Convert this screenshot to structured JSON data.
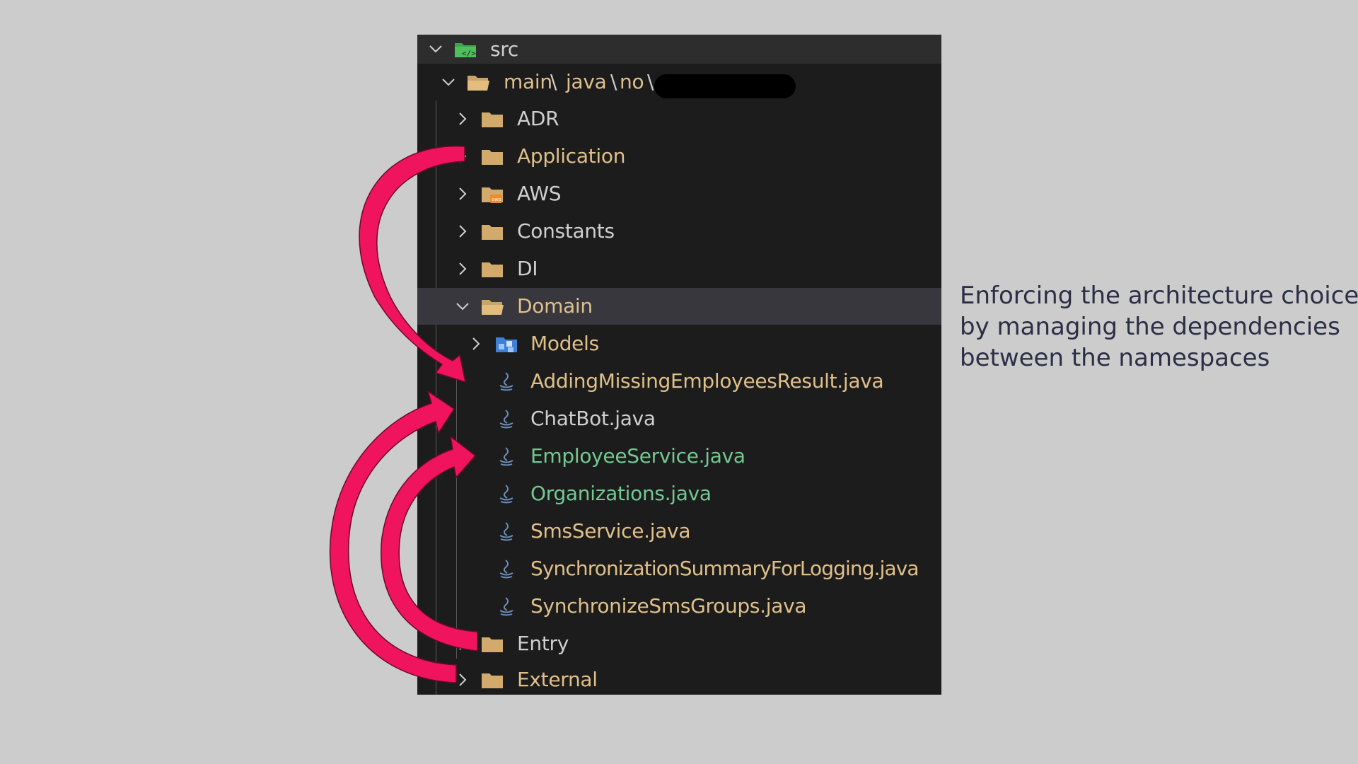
{
  "explorer": {
    "root": {
      "label": "src",
      "icon": "source-folder-icon"
    },
    "package_path": {
      "segments": [
        "main",
        "java",
        "no"
      ],
      "separator": "\\"
    },
    "items": [
      {
        "label": "ADR",
        "icon": "folder-icon",
        "state": "collapsed"
      },
      {
        "label": "Application",
        "icon": "folder-icon",
        "state": "collapsed"
      },
      {
        "label": "AWS",
        "icon": "aws-folder-icon",
        "state": "collapsed"
      },
      {
        "label": "Constants",
        "icon": "folder-icon",
        "state": "collapsed"
      },
      {
        "label": "DI",
        "icon": "folder-icon",
        "state": "collapsed"
      },
      {
        "label": "Domain",
        "icon": "folder-open-icon",
        "state": "expanded",
        "selected": true
      },
      {
        "label": "Models",
        "icon": "models-folder-icon",
        "state": "collapsed"
      },
      {
        "label": "AddingMissingEmployeesResult.java",
        "icon": "java-file-icon",
        "color": "#e0c08a"
      },
      {
        "label": "ChatBot.java",
        "icon": "java-file-icon",
        "color": "#cfcfcf"
      },
      {
        "label": "EmployeeService.java",
        "icon": "java-file-icon",
        "color": "#73c991"
      },
      {
        "label": "Organizations.java",
        "icon": "java-file-icon",
        "color": "#73c991"
      },
      {
        "label": "SmsService.java",
        "icon": "java-file-icon",
        "color": "#e0c08a"
      },
      {
        "label": "SynchronizationSummaryForLogging.java",
        "icon": "java-file-icon",
        "color": "#e0c08a"
      },
      {
        "label": "SynchronizeSmsGroups.java",
        "icon": "java-file-icon",
        "color": "#e0c08a"
      },
      {
        "label": "Entry",
        "icon": "folder-icon",
        "state": "collapsed"
      },
      {
        "label": "External",
        "icon": "folder-icon",
        "state": "collapsed"
      }
    ]
  },
  "caption": {
    "lines": [
      "Enforcing the architecture choice",
      "by managing the dependencies",
      "between the namespaces"
    ]
  },
  "colors": {
    "arrow": "#f0145f",
    "background": "#cccccc",
    "explorer_bg": "#1c1c1c",
    "selected_row": "#37373d"
  }
}
